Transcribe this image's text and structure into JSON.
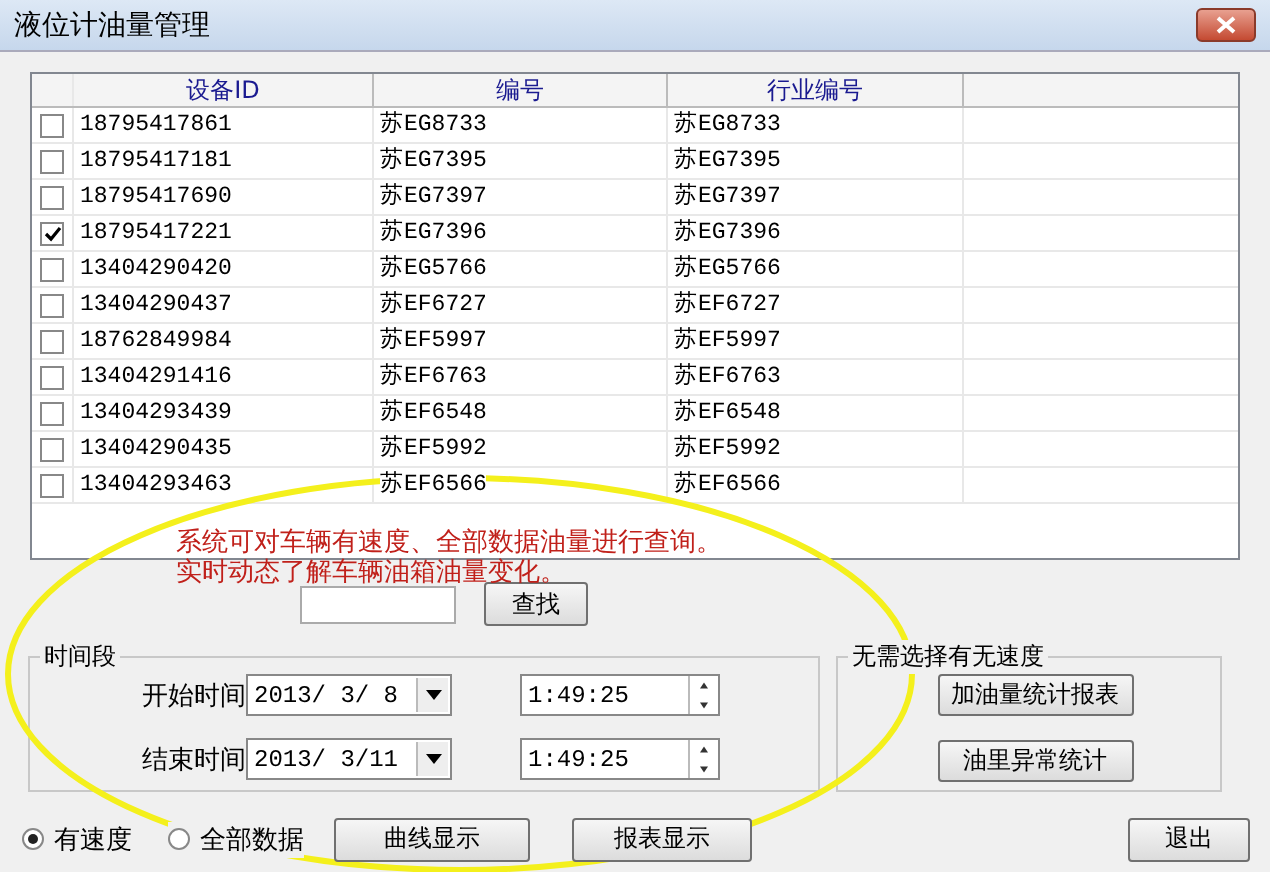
{
  "window": {
    "title": "液位计油量管理"
  },
  "table": {
    "columns": [
      "设备ID",
      "编号",
      "行业编号"
    ],
    "rows": [
      {
        "checked": false,
        "cells": [
          "18795417861",
          "苏EG8733",
          "苏EG8733"
        ]
      },
      {
        "checked": false,
        "cells": [
          "18795417181",
          "苏EG7395",
          "苏EG7395"
        ]
      },
      {
        "checked": false,
        "cells": [
          "18795417690",
          "苏EG7397",
          "苏EG7397"
        ]
      },
      {
        "checked": true,
        "cells": [
          "18795417221",
          "苏EG7396",
          "苏EG7396"
        ]
      },
      {
        "checked": false,
        "cells": [
          "13404290420",
          "苏EG5766",
          "苏EG5766"
        ]
      },
      {
        "checked": false,
        "cells": [
          "13404290437",
          "苏EF6727",
          "苏EF6727"
        ]
      },
      {
        "checked": false,
        "cells": [
          "18762849984",
          "苏EF5997",
          "苏EF5997"
        ]
      },
      {
        "checked": false,
        "cells": [
          "13404291416",
          "苏EF6763",
          "苏EF6763"
        ]
      },
      {
        "checked": false,
        "cells": [
          "13404293439",
          "苏EF6548",
          "苏EF6548"
        ]
      },
      {
        "checked": false,
        "cells": [
          "13404290435",
          "苏EF5992",
          "苏EF5992"
        ]
      },
      {
        "checked": false,
        "cells": [
          "13404293463",
          "苏EF6566",
          "苏EF6566"
        ]
      }
    ]
  },
  "annotation": {
    "lines": [
      "系统可对车辆有速度、全部数据油量进行查询。",
      "实时动态了解车辆油箱油量变化。"
    ]
  },
  "search": {
    "button": "查找"
  },
  "time_range": {
    "title": "时间段",
    "rows": [
      {
        "label": "开始时间",
        "date": "2013/ 3/ 8",
        "time": "1:49:25"
      },
      {
        "label": "结束时间",
        "date": "2013/ 3/11",
        "time": "1:49:25"
      }
    ]
  },
  "reports": {
    "title": "无需选择有无速度",
    "buttons": [
      "加油量统计报表",
      "油里异常统计"
    ]
  },
  "mode": [
    {
      "label": "有速度",
      "selected": true
    },
    {
      "label": "全部数据",
      "selected": false
    }
  ],
  "buttons": [
    "曲线显示",
    "报表显示"
  ],
  "exit": "退出"
}
